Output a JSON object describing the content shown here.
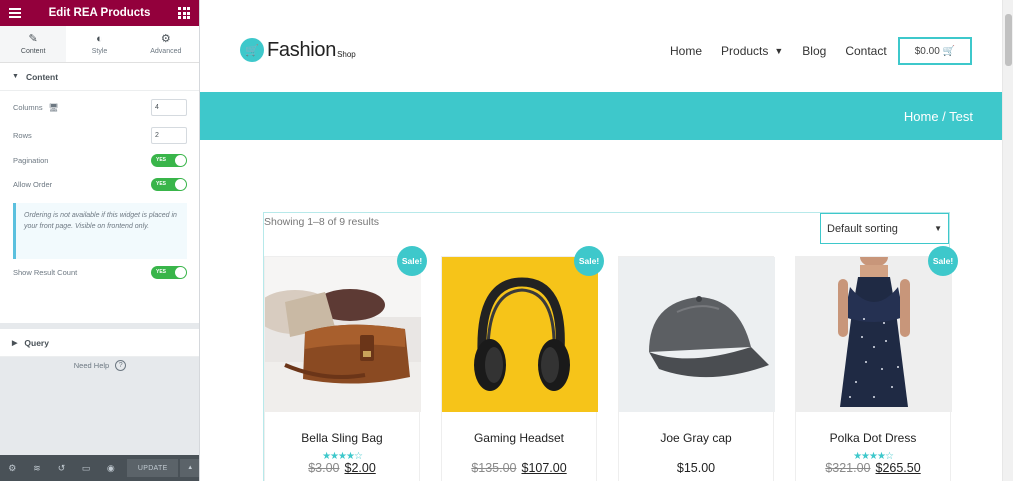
{
  "panel": {
    "title": "Edit REA Products",
    "tabs": [
      {
        "label": "Content",
        "icon": "pencil-icon"
      },
      {
        "label": "Style",
        "icon": "half-circle-icon"
      },
      {
        "label": "Advanced",
        "icon": "gear-icon"
      }
    ],
    "content_section": {
      "title": "Content",
      "columns_label": "Columns",
      "columns_value": "4",
      "rows_label": "Rows",
      "rows_value": "2",
      "pagination_label": "Pagination",
      "pagination_state": "YES",
      "allow_order_label": "Allow Order",
      "allow_order_state": "YES",
      "notice": "Ordering is not available if this widget is placed in your front page. Visible on frontend only.",
      "show_result_count_label": "Show Result Count",
      "show_result_count_state": "YES"
    },
    "query_section": {
      "title": "Query"
    },
    "need_help": "Need Help",
    "footer": {
      "update_label": "UPDATE"
    }
  },
  "site": {
    "logo_word": "Fashion",
    "logo_sub": "Shop",
    "nav": [
      "Home",
      "Products",
      "Blog",
      "Contact"
    ],
    "cart_label": "$0.00",
    "breadcrumb": "Home / Test"
  },
  "shop": {
    "result_count": "Showing 1–8 of 9 results",
    "sorting": "Default sorting",
    "sale_badge": "Sale!",
    "products": [
      {
        "name": "Bella Sling Bag",
        "rating": 4,
        "old_price": "$3.00",
        "price": "$2.00",
        "sale": true
      },
      {
        "name": "Gaming Headset",
        "rating": 0,
        "old_price": "$135.00",
        "price": "$107.00",
        "sale": true
      },
      {
        "name": "Joe Gray cap",
        "rating": 0,
        "old_price": "",
        "price": "$15.00",
        "sale": false
      },
      {
        "name": "Polka Dot Dress",
        "rating": 4,
        "old_price": "$321.00",
        "price": "$265.50",
        "sale": true
      }
    ]
  },
  "colors": {
    "accent": "#3ec8cb",
    "panel_header": "#93003c",
    "switch_on": "#39b54a"
  }
}
